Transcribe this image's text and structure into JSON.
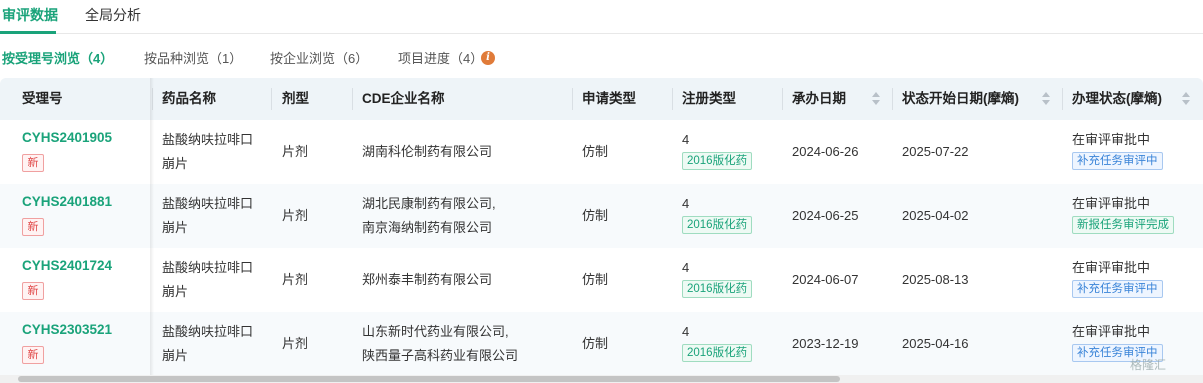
{
  "top_tabs": [
    {
      "label": "审评数据"
    },
    {
      "label": "全局分析"
    }
  ],
  "sub_tabs": [
    {
      "label": "按受理号浏览（4）"
    },
    {
      "label": "按品种浏览（1）"
    },
    {
      "label": "按企业浏览（6）"
    },
    {
      "label": "项目进度（4）"
    }
  ],
  "table": {
    "headers": [
      "受理号",
      "药品名称",
      "剂型",
      "CDE企业名称",
      "申请类型",
      "注册类型",
      "承办日期",
      "状态开始日期(摩熵)",
      "办理状态(摩熵)"
    ],
    "rows": [
      {
        "acceptance_no": "CYHS2401905",
        "new_tag": "新",
        "drug_name_line1": "盐酸纳呋拉啡口",
        "drug_name_line2": "崩片",
        "dosage_form": "片剂",
        "company_line1": "湖南科伦制药有限公司",
        "company_line2": "",
        "application_type": "仿制",
        "reg_type": "4",
        "reg_tag": "2016版化药",
        "undertake_date": "2024-06-26",
        "status_start_date": "2025-07-22",
        "status": "在审评审批中",
        "status_tag": "补充任务审评中",
        "status_tag_kind": "blue"
      },
      {
        "acceptance_no": "CYHS2401881",
        "new_tag": "新",
        "drug_name_line1": "盐酸纳呋拉啡口",
        "drug_name_line2": "崩片",
        "dosage_form": "片剂",
        "company_line1": "湖北民康制药有限公司,",
        "company_line2": "南京海纳制药有限公司",
        "application_type": "仿制",
        "reg_type": "4",
        "reg_tag": "2016版化药",
        "undertake_date": "2024-06-25",
        "status_start_date": "2025-04-02",
        "status": "在审评审批中",
        "status_tag": "新报任务审评完成",
        "status_tag_kind": "green"
      },
      {
        "acceptance_no": "CYHS2401724",
        "new_tag": "新",
        "drug_name_line1": "盐酸纳呋拉啡口",
        "drug_name_line2": "崩片",
        "dosage_form": "片剂",
        "company_line1": "郑州泰丰制药有限公司",
        "company_line2": "",
        "application_type": "仿制",
        "reg_type": "4",
        "reg_tag": "2016版化药",
        "undertake_date": "2024-06-07",
        "status_start_date": "2025-08-13",
        "status": "在审评审批中",
        "status_tag": "补充任务审评中",
        "status_tag_kind": "blue"
      },
      {
        "acceptance_no": "CYHS2303521",
        "new_tag": "新",
        "drug_name_line1": "盐酸纳呋拉啡口",
        "drug_name_line2": "崩片",
        "dosage_form": "片剂",
        "company_line1": "山东新时代药业有限公司,",
        "company_line2": "陕西量子高科药业有限公司",
        "application_type": "仿制",
        "reg_type": "4",
        "reg_tag": "2016版化药",
        "undertake_date": "2023-12-19",
        "status_start_date": "2025-04-16",
        "status": "在审评审批中",
        "status_tag": "补充任务审评中",
        "status_tag_kind": "blue"
      }
    ]
  },
  "watermark": "格隆汇",
  "colors": {
    "accent": "#1aa37a",
    "header_bg": "#eef4f8",
    "new_tag": "#e04848",
    "blue_tag": "#3a84d8",
    "info_icon": "#e07b39"
  }
}
